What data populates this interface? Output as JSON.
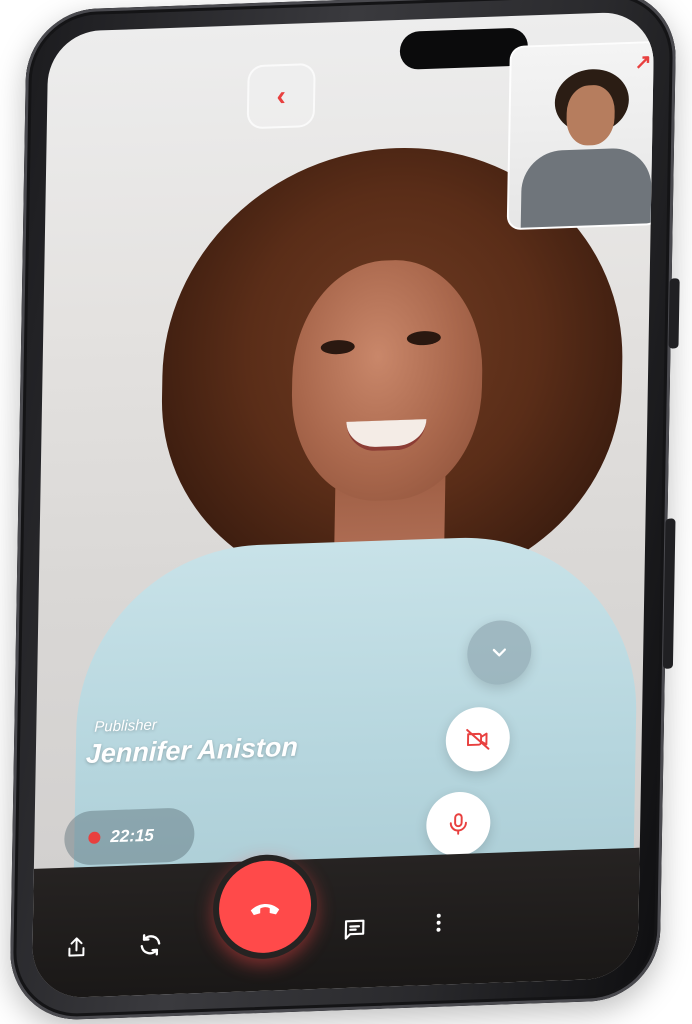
{
  "caller": {
    "role": "Publisher",
    "name": "Jennifer Aniston"
  },
  "call": {
    "duration": "22:15",
    "recording": true
  },
  "colors": {
    "accent": "#e8403f",
    "end_call": "#ff4a4a",
    "bottom_bar": "#1f1c1b"
  },
  "icons": {
    "back": "chevron-left-icon",
    "expand": "arrow-up-right-icon",
    "collapse": "chevron-down-icon",
    "camera_off": "video-off-icon",
    "mic": "microphone-icon",
    "end_call": "phone-hangup-icon",
    "share": "share-icon",
    "switch_camera": "refresh-icon",
    "chat": "chat-icon",
    "more": "more-vertical-icon"
  }
}
